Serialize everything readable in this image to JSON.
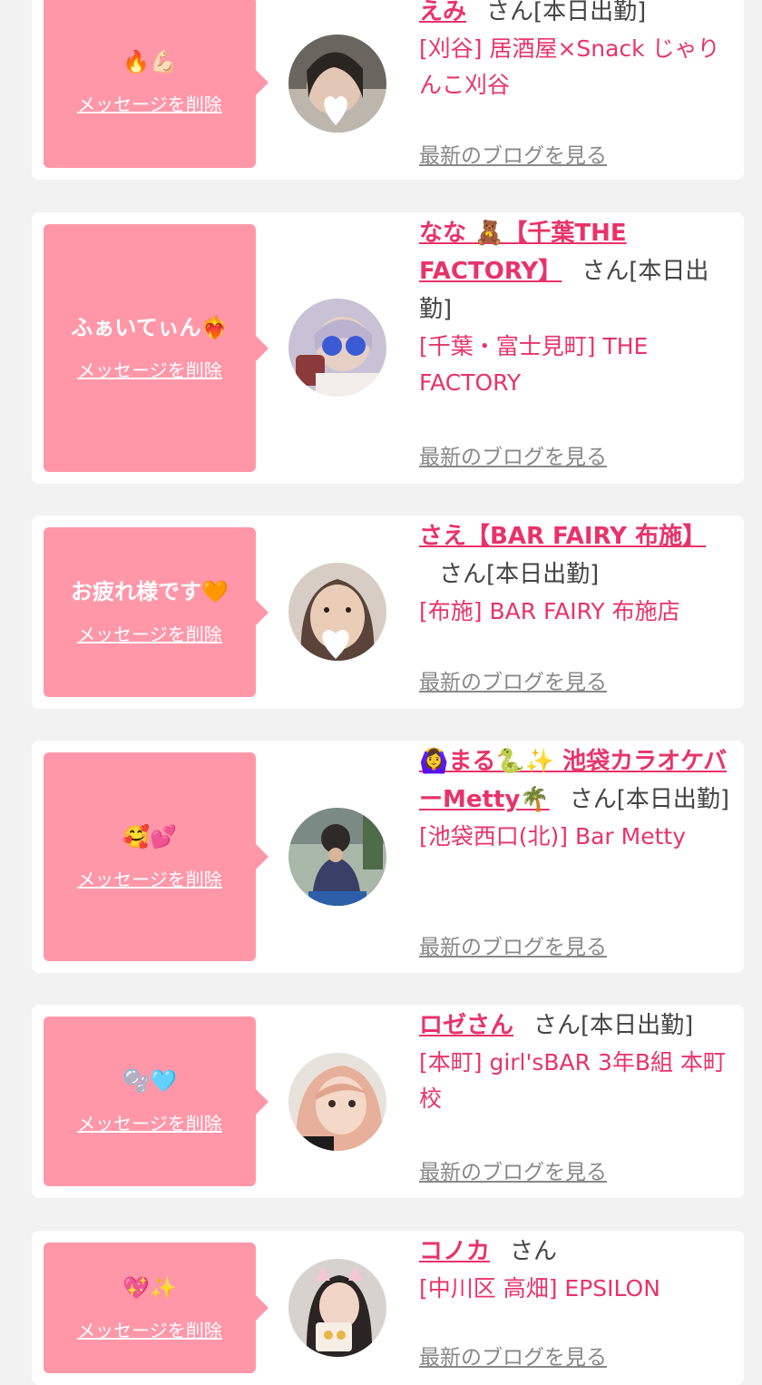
{
  "colors": {
    "accent": "#e8336a",
    "bubble": "#ff97a9",
    "background": "#f2f2f2"
  },
  "cards": [
    {
      "message": "🔥💪🏻",
      "delete_label": "メッセージを削除",
      "name": "えみ",
      "honorific": "さん",
      "status": "[本日出勤]",
      "shop": "[刈谷] 居酒屋×Snack じゃりんこ刈谷",
      "blog_label": "最新のブログを見る",
      "avatar_icon": "avatar-photo"
    },
    {
      "message": "ふぁいてぃん❤️‍🔥",
      "delete_label": "メッセージを削除",
      "name": "なな 🧸【千葉THE FACTORY】",
      "honorific": "さん",
      "status": "[本日出勤]",
      "shop": "[千葉・富士見町] THE FACTORY",
      "blog_label": "最新のブログを見る",
      "avatar_icon": "avatar-photo"
    },
    {
      "message": "お疲れ様です🧡",
      "delete_label": "メッセージを削除",
      "name": "さえ【BAR FAIRY 布施】",
      "honorific": "さん",
      "status": "[本日出勤]",
      "shop": "[布施] BAR FAIRY 布施店",
      "blog_label": "最新のブログを見る",
      "avatar_icon": "avatar-photo"
    },
    {
      "message": "🥰💕",
      "delete_label": "メッセージを削除",
      "name": "🙆‍♀️まる🐍✨ 池袋カラオケバーMetty🌴",
      "honorific": "さん",
      "status": "[本日出勤]",
      "shop": "[池袋西口(北)] Bar Metty",
      "blog_label": "最新のブログを見る",
      "avatar_icon": "avatar-photo"
    },
    {
      "message": "🫧🩵",
      "delete_label": "メッセージを削除",
      "name": "ロゼさん",
      "honorific": "さん",
      "status": "[本日出勤]",
      "shop": "[本町] girl'sBAR 3年B組 本町校",
      "blog_label": "最新のブログを見る",
      "avatar_icon": "avatar-photo"
    },
    {
      "message": "💖✨",
      "delete_label": "メッセージを削除",
      "name": "コノカ",
      "honorific": "さん",
      "status": "",
      "shop": "[中川区 高畑] EPSILON",
      "blog_label": "最新のブログを見る",
      "avatar_icon": "avatar-photo"
    }
  ]
}
